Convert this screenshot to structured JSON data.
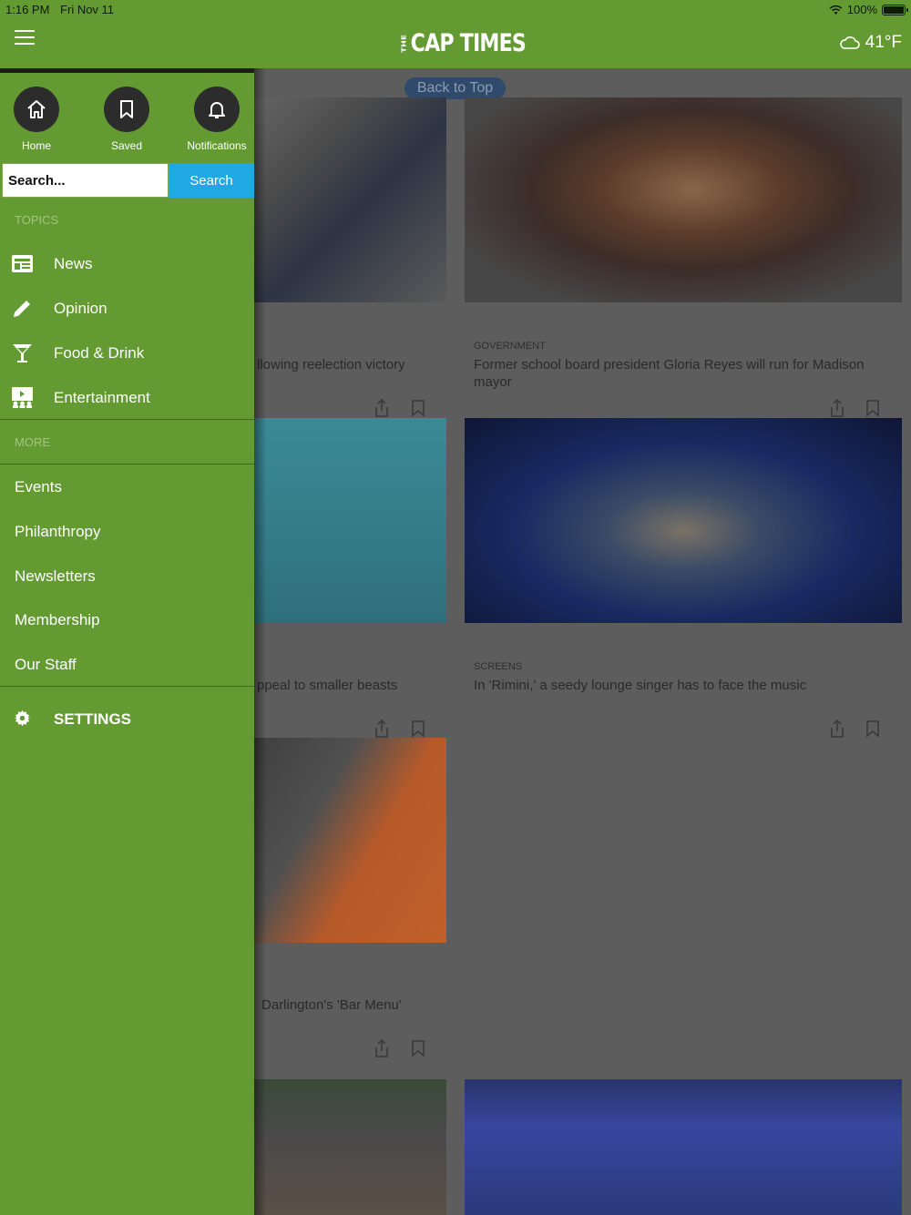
{
  "status_bar": {
    "time": "1:16 PM",
    "date": "Fri Nov 11",
    "battery": "100%"
  },
  "header": {
    "logo_small": "THE",
    "logo": "CAP TIMES",
    "temperature": "41°F",
    "icon_menu": "hamburger-icon",
    "icon_weather": "cloud-icon"
  },
  "menu": {
    "quick_links": [
      {
        "label": "Home",
        "icon": "home-icon"
      },
      {
        "label": "Saved",
        "icon": "bookmark-icon"
      },
      {
        "label": "Notifications",
        "icon": "bell-icon"
      }
    ],
    "search_placeholder": "Search...",
    "search_button": "Search",
    "topics_label": "TOPICS",
    "topics": [
      {
        "label": "News",
        "icon": "newspaper-icon"
      },
      {
        "label": "Opinion",
        "icon": "pencil-icon"
      },
      {
        "label": "Food & Drink",
        "icon": "cocktail-icon"
      },
      {
        "label": "Entertainment",
        "icon": "theater-icon"
      }
    ],
    "more_label": "MORE",
    "more_items": [
      "Events",
      "Philanthropy",
      "Newsletters",
      "Membership",
      "Our Staff"
    ],
    "settings_label": "SETTINGS"
  },
  "content": {
    "back_to_top": "Back to Top",
    "articles": [
      {
        "category": "",
        "headline": "llowing reelection victory"
      },
      {
        "category": "GOVERNMENT",
        "headline": "Former school board president Gloria Reyes will run for Madison mayor"
      },
      {
        "category": "",
        "headline": "ppeal to smaller beasts"
      },
      {
        "category": "SCREENS",
        "headline": "In 'Rimini,' a seedy lounge singer has to face the music"
      },
      {
        "category": "",
        "headline": "Darlington's 'Bar Menu'"
      }
    ]
  },
  "colors": {
    "brand_green": "#639a32",
    "search_blue": "#1fa8e4",
    "back_to_top_bg": "#2f4a6a"
  }
}
